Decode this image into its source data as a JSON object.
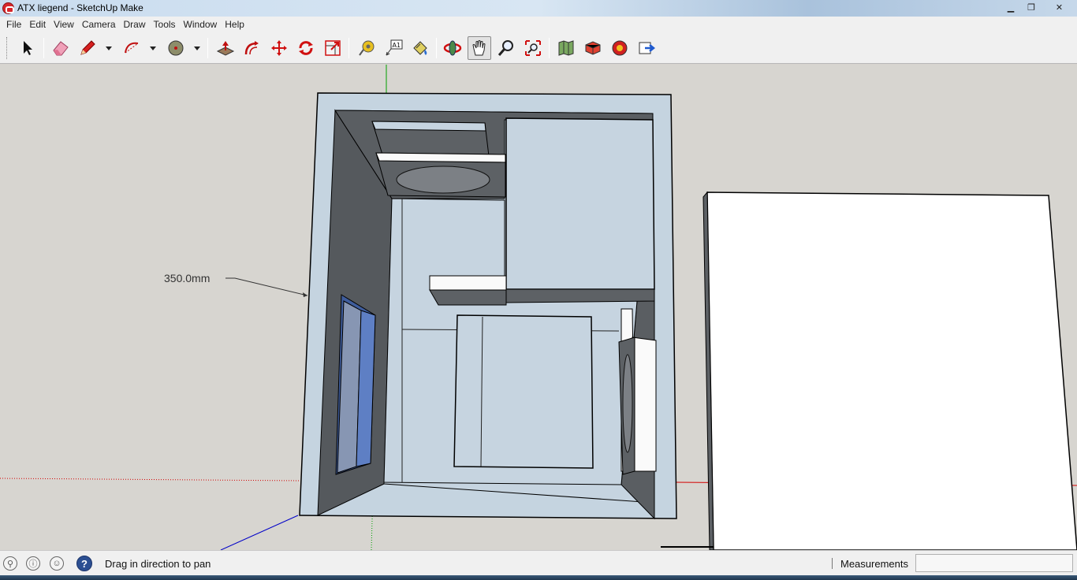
{
  "window": {
    "title": "ATX liegend - SketchUp Make",
    "controls": {
      "minimize": "▁",
      "restore": "❐",
      "close": "✕"
    }
  },
  "menu": [
    "File",
    "Edit",
    "View",
    "Camera",
    "Draw",
    "Tools",
    "Window",
    "Help"
  ],
  "toolbar": {
    "tools": [
      {
        "name": "select-tool",
        "icon": "arrow-cursor-icon"
      },
      {
        "name": "eraser-tool",
        "icon": "eraser-icon"
      },
      {
        "name": "line-tool",
        "icon": "pencil-icon",
        "dropdown": true
      },
      {
        "name": "arc-tool",
        "icon": "arc-icon",
        "dropdown": true
      },
      {
        "name": "shape-tool",
        "icon": "circle-icon",
        "dropdown": true
      },
      {
        "name": "push-pull-tool",
        "icon": "push-pull-icon"
      },
      {
        "name": "offset-tool",
        "icon": "offset-icon"
      },
      {
        "name": "move-tool",
        "icon": "move-arrows-icon"
      },
      {
        "name": "rotate-tool",
        "icon": "rotate-icon"
      },
      {
        "name": "scale-tool",
        "icon": "scale-icon"
      },
      {
        "name": "tape-measure-tool",
        "icon": "tape-measure-icon"
      },
      {
        "name": "text-tool",
        "icon": "text-label-icon",
        "label": "A1"
      },
      {
        "name": "paint-bucket-tool",
        "icon": "paint-bucket-icon"
      },
      {
        "name": "orbit-tool",
        "icon": "orbit-icon"
      },
      {
        "name": "pan-tool",
        "icon": "hand-icon",
        "active": true
      },
      {
        "name": "zoom-tool",
        "icon": "magnifier-icon"
      },
      {
        "name": "zoom-extents-tool",
        "icon": "zoom-extents-icon"
      },
      {
        "name": "warehouse-tool",
        "icon": "map-icon"
      },
      {
        "name": "components-tool",
        "icon": "components-icon"
      },
      {
        "name": "extension-tool",
        "icon": "extension-icon"
      },
      {
        "name": "share-model-tool",
        "icon": "share-icon"
      }
    ]
  },
  "viewport": {
    "dimension_label": "350.0mm"
  },
  "statusbar": {
    "hint": "Drag in direction to pan",
    "help_glyph": "?",
    "measurements_label": "Measurements",
    "measurements_value": ""
  },
  "colors": {
    "face": "#c5d4e0",
    "inner_dark": "#55595d",
    "glass": "#7f8fb8",
    "axis_red": "#d40000",
    "axis_green": "#00a000",
    "axis_blue": "#0000c8"
  }
}
